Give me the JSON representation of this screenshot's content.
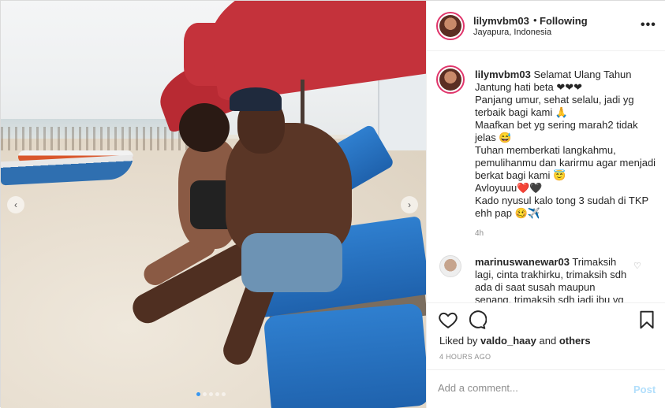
{
  "post": {
    "username": "lilymvbm03",
    "separator": "•",
    "follow_status": "Following",
    "location": "Jayapura, Indonesia",
    "more_label": "•••"
  },
  "caption": {
    "username": "lilymvbm03",
    "lines": [
      "Selamat Ulang Tahun",
      "Jantung hati beta ❤❤❤",
      "Panjang umur, sehat selalu, jadi yg terbaik bagi kami 🙏",
      "Maafkan bet yg sering marah2 tidak jelas 😅",
      "Tuhan memberkati langkahmu, pemulihanmu dan karirmu agar menjadi berkat bagi kami 😇",
      "Avloyuuu❤️🖤",
      "Kado nyusul kalo tong 3 sudah di TKP ehh pap 🥴✈️"
    ],
    "time": "4h"
  },
  "comment": {
    "username": "marinuswanewar03",
    "text": "Trimaksih lagi, cinta trakhirku, trimaksih sdh ada di saat susah maupun senang, trimaksih sdh jadi ibu yg"
  },
  "actions": {
    "like_icon": "heart-icon",
    "comment_icon": "comment-bubble-icon",
    "save_icon": "bookmark-icon"
  },
  "likes": {
    "prefix": "Liked by",
    "user": "valdo_haay",
    "and": "and",
    "others": "others"
  },
  "timestamp": "4 HOURS AGO",
  "add_comment": {
    "placeholder": "Add a comment...",
    "post_label": "Post"
  },
  "carousel": {
    "total_slides": 5,
    "active_index": 0,
    "prev_label": "‹",
    "next_label": "›"
  }
}
